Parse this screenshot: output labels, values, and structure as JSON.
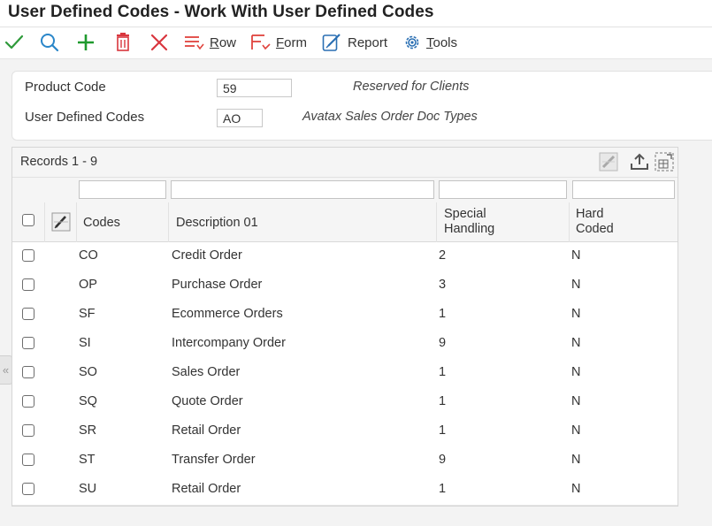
{
  "title": "User Defined Codes - Work With User Defined Codes",
  "toolbar": {
    "row_label": "Row",
    "form_label": "Form",
    "report_label": "Report",
    "tools_label": "Tools",
    "row_accel": "R",
    "form_accel": "F",
    "tools_accel": "T"
  },
  "header": {
    "product_code_label": "Product Code",
    "product_code_value": "59",
    "product_code_desc": "Reserved for Clients",
    "udc_label": "User Defined Codes",
    "udc_value": "AO",
    "udc_desc": "Avatax Sales Order Doc Types"
  },
  "grid": {
    "records_label": "Records 1 - 9",
    "columns": {
      "codes": "Codes",
      "description": "Description 01",
      "special_1": "Special",
      "special_2": "Handling",
      "hard_1": "Hard",
      "hard_2": "Coded"
    },
    "rows": [
      {
        "code": "CO",
        "desc": "Credit Order",
        "special": "2",
        "hard": "N"
      },
      {
        "code": "OP",
        "desc": "Purchase Order",
        "special": "3",
        "hard": "N"
      },
      {
        "code": "SF",
        "desc": "Ecommerce Orders",
        "special": "1",
        "hard": "N"
      },
      {
        "code": "SI",
        "desc": "Intercompany Order",
        "special": "9",
        "hard": "N"
      },
      {
        "code": "SO",
        "desc": "Sales Order",
        "special": "1",
        "hard": "N"
      },
      {
        "code": "SQ",
        "desc": "Quote Order",
        "special": "1",
        "hard": "N"
      },
      {
        "code": "SR",
        "desc": "Retail Order",
        "special": "1",
        "hard": "N"
      },
      {
        "code": "ST",
        "desc": "Transfer Order",
        "special": "9",
        "hard": "N"
      },
      {
        "code": "SU",
        "desc": "Retail Order",
        "special": "1",
        "hard": "N"
      }
    ]
  },
  "colors": {
    "select_green": "#2e9a3a",
    "find_blue": "#2a86c9",
    "add_green": "#1f9a2e",
    "delete_red": "#d9363e",
    "close_red": "#d9363e",
    "menu_icon_red": "#e0443e",
    "menu_icon_blue": "#2a6fb3"
  },
  "icons": [
    "select-check-icon",
    "find-search-icon",
    "add-plus-icon",
    "delete-trash-icon",
    "close-x-icon",
    "row-menu-icon",
    "form-menu-icon",
    "report-icon",
    "tools-gear-icon",
    "grid-personalize-icon",
    "export-upload-icon",
    "grid-maximize-icon",
    "column-edit-icon",
    "collapse-chevron-icon"
  ]
}
